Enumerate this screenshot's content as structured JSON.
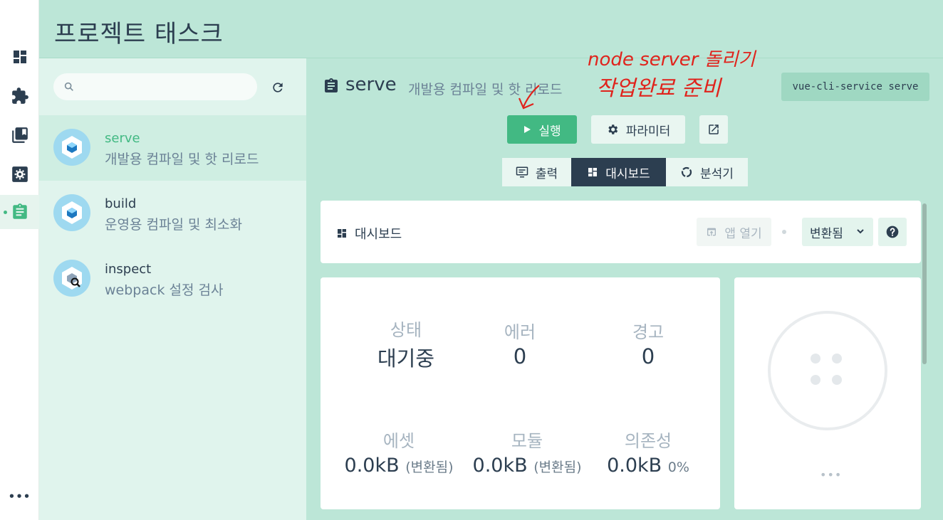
{
  "header": {
    "title": "프로젝트 태스크"
  },
  "rail": {
    "items": [
      {
        "name": "dashboard",
        "icon": "dashboard-icon"
      },
      {
        "name": "plugins",
        "icon": "puzzle-icon"
      },
      {
        "name": "dependencies",
        "icon": "library-icon"
      },
      {
        "name": "configuration",
        "icon": "gear-icon"
      },
      {
        "name": "tasks",
        "icon": "clipboard-icon",
        "active": true
      }
    ],
    "more": "•••"
  },
  "task_list": {
    "search_placeholder": "",
    "items": [
      {
        "name": "serve",
        "desc": "개발용 컴파일 및 핫 리로드",
        "selected": true
      },
      {
        "name": "build",
        "desc": "운영용 컴파일 및 최소화"
      },
      {
        "name": "inspect",
        "desc": "webpack 설정 검사"
      }
    ]
  },
  "task": {
    "name": "serve",
    "desc": "개발용 컴파일 및 핫 리로드",
    "command": "vue-cli-service serve",
    "run_label": "실행",
    "params_label": "파라미터"
  },
  "tabs": [
    {
      "label": "출력",
      "active": false
    },
    {
      "label": "대시보드",
      "active": true
    },
    {
      "label": "분석기",
      "active": false
    }
  ],
  "dashboard": {
    "title": "대시보드",
    "open_app_label": "앱 열기",
    "mode_label": "변환됨",
    "stats": {
      "status": {
        "label": "상태",
        "value": "대기중"
      },
      "errors": {
        "label": "에러",
        "value": "0"
      },
      "warnings": {
        "label": "경고",
        "value": "0"
      },
      "assets": {
        "label": "에셋",
        "value": "0.0kB",
        "sub": "(변환됨)"
      },
      "modules": {
        "label": "모듈",
        "value": "0.0kB",
        "sub": "(변환됨)"
      },
      "deps": {
        "label": "의존성",
        "value": "0.0kB",
        "sub": "0%"
      }
    },
    "more": "•••"
  },
  "annotation": {
    "line1": "node server 돌리기",
    "line2": "작업완료 준비",
    "color": "#e0231c"
  },
  "colors": {
    "accent": "#42b983",
    "dark": "#2c3e50",
    "header_bg": "#bce6d7"
  }
}
